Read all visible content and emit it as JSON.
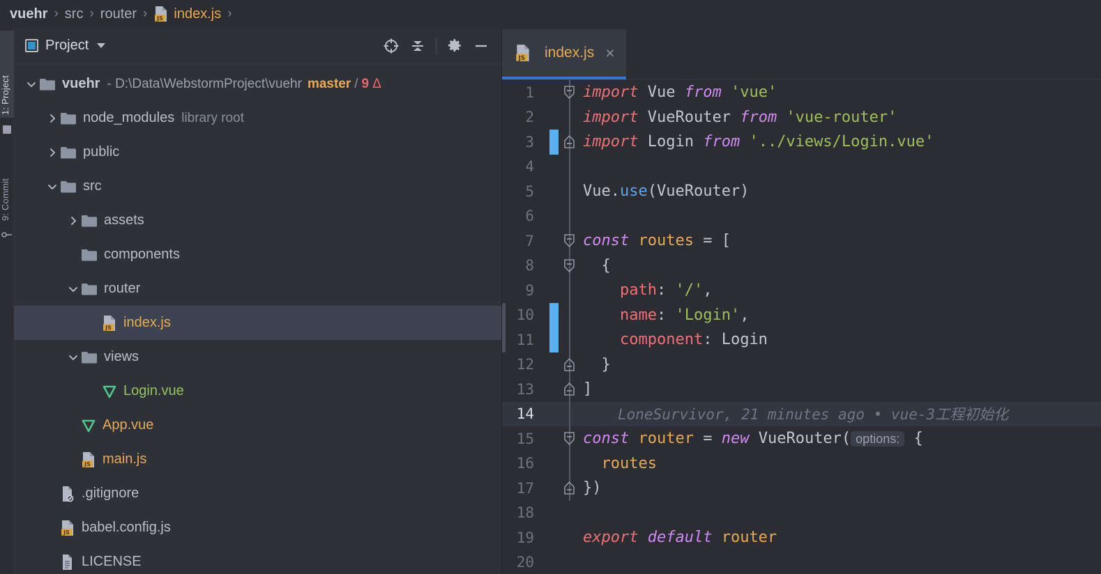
{
  "breadcrumb": {
    "items": [
      {
        "label": "vuehr",
        "style": "bold"
      },
      {
        "label": "src",
        "style": "plain"
      },
      {
        "label": "router",
        "style": "plain"
      },
      {
        "label": "index.js",
        "style": "file",
        "icon": "js-file-icon"
      }
    ],
    "separator": "›"
  },
  "tool_strip": {
    "tabs": [
      {
        "label": "1: Project",
        "active": true,
        "icon": "project-icon"
      },
      {
        "label": "9: Commit",
        "active": false,
        "icon": "branch-icon"
      }
    ]
  },
  "project_panel": {
    "title": "Project",
    "dropdown_icon": "chevron-down-icon",
    "actions": [
      {
        "name": "select-opened-file-icon",
        "title": "Select Opened File"
      },
      {
        "name": "collapse-all-icon",
        "title": "Collapse All"
      },
      {
        "name": "gear-icon",
        "title": "Settings"
      },
      {
        "name": "minimize-icon",
        "title": "Hide"
      }
    ],
    "tree": [
      {
        "id": "root-vuehr",
        "label": "vuehr",
        "indent": 0,
        "twisty": "expanded",
        "icon": "folder-icon",
        "kind": "folder-root",
        "path": "- D:\\Data\\WebstormProject\\vuehr",
        "branch": "master",
        "slash": "/",
        "changes": "9",
        "changes_glyph": "Δ"
      },
      {
        "id": "node_modules",
        "label": "node_modules",
        "indent": 1,
        "twisty": "collapsed",
        "icon": "folder-icon",
        "kind": "folder",
        "sub": "library root"
      },
      {
        "id": "public",
        "label": "public",
        "indent": 1,
        "twisty": "collapsed",
        "icon": "folder-icon",
        "kind": "folder"
      },
      {
        "id": "src",
        "label": "src",
        "indent": 1,
        "twisty": "expanded",
        "icon": "folder-icon",
        "kind": "folder"
      },
      {
        "id": "assets",
        "label": "assets",
        "indent": 2,
        "twisty": "collapsed",
        "icon": "folder-icon",
        "kind": "folder"
      },
      {
        "id": "components",
        "label": "components",
        "indent": 2,
        "twisty": "none",
        "icon": "folder-icon",
        "kind": "folder"
      },
      {
        "id": "router",
        "label": "router",
        "indent": 2,
        "twisty": "expanded",
        "icon": "folder-icon",
        "kind": "folder"
      },
      {
        "id": "router-index",
        "label": "index.js",
        "indent": 3,
        "twisty": "none",
        "icon": "js-file-icon",
        "kind": "js",
        "selected": true
      },
      {
        "id": "views",
        "label": "views",
        "indent": 2,
        "twisty": "expanded",
        "icon": "folder-icon",
        "kind": "folder"
      },
      {
        "id": "login-vue",
        "label": "Login.vue",
        "indent": 3,
        "twisty": "none",
        "icon": "vue-file-icon",
        "kind": "vue"
      },
      {
        "id": "app-vue",
        "label": "App.vue",
        "indent": 2,
        "twisty": "none",
        "icon": "vue-file-icon",
        "kind": "vue-orange"
      },
      {
        "id": "main-js",
        "label": "main.js",
        "indent": 2,
        "twisty": "none",
        "icon": "js-file-icon",
        "kind": "js"
      },
      {
        "id": "gitignore",
        "label": ".gitignore",
        "indent": 1,
        "twisty": "none",
        "icon": "gitignore-file-icon",
        "kind": "plain"
      },
      {
        "id": "babel-config",
        "label": "babel.config.js",
        "indent": 1,
        "twisty": "none",
        "icon": "js-file-icon",
        "kind": "plain"
      },
      {
        "id": "license",
        "label": "LICENSE",
        "indent": 1,
        "twisty": "none",
        "icon": "text-file-icon",
        "kind": "plain"
      }
    ]
  },
  "editor": {
    "tabs": [
      {
        "label": "index.js",
        "icon": "js-file-icon",
        "active": true,
        "close_glyph": "×"
      }
    ],
    "current_line": 14,
    "lines": [
      {
        "n": 1,
        "fold": "start",
        "change": false,
        "tokens": [
          {
            "t": "import",
            "c": "kw2"
          },
          {
            "t": " ",
            "c": "op"
          },
          {
            "t": "Vue",
            "c": "ident"
          },
          {
            "t": " ",
            "c": "op"
          },
          {
            "t": "from",
            "c": "kw"
          },
          {
            "t": " ",
            "c": "op"
          },
          {
            "t": "'vue'",
            "c": "str"
          }
        ]
      },
      {
        "n": 2,
        "fold": "none",
        "change": false,
        "tokens": [
          {
            "t": "import",
            "c": "kw2"
          },
          {
            "t": " ",
            "c": "op"
          },
          {
            "t": "VueRouter",
            "c": "ident"
          },
          {
            "t": " ",
            "c": "op"
          },
          {
            "t": "from",
            "c": "kw"
          },
          {
            "t": " ",
            "c": "op"
          },
          {
            "t": "'vue-router'",
            "c": "str"
          }
        ]
      },
      {
        "n": 3,
        "fold": "end",
        "change": true,
        "tokens": [
          {
            "t": "import",
            "c": "kw2"
          },
          {
            "t": " ",
            "c": "op"
          },
          {
            "t": "Login",
            "c": "ident"
          },
          {
            "t": " ",
            "c": "op"
          },
          {
            "t": "from",
            "c": "kw"
          },
          {
            "t": " ",
            "c": "op"
          },
          {
            "t": "'../views/Login.vue'",
            "c": "str"
          }
        ]
      },
      {
        "n": 4,
        "fold": "none",
        "change": false,
        "tokens": []
      },
      {
        "n": 5,
        "fold": "none",
        "change": false,
        "tokens": [
          {
            "t": "Vue.",
            "c": "ident"
          },
          {
            "t": "use",
            "c": "fn"
          },
          {
            "t": "(VueRouter)",
            "c": "ident"
          }
        ]
      },
      {
        "n": 6,
        "fold": "none",
        "change": false,
        "tokens": []
      },
      {
        "n": 7,
        "fold": "start",
        "change": false,
        "tokens": [
          {
            "t": "const",
            "c": "kw"
          },
          {
            "t": " ",
            "c": "op"
          },
          {
            "t": "routes",
            "c": "var"
          },
          {
            "t": " = [",
            "c": "op"
          }
        ]
      },
      {
        "n": 8,
        "fold": "start",
        "change": false,
        "tokens": [
          {
            "t": "  {",
            "c": "op"
          }
        ]
      },
      {
        "n": 9,
        "fold": "none",
        "change": false,
        "tokens": [
          {
            "t": "    ",
            "c": "op"
          },
          {
            "t": "path",
            "c": "prop"
          },
          {
            "t": ": ",
            "c": "op"
          },
          {
            "t": "'/'",
            "c": "str"
          },
          {
            "t": ",",
            "c": "op"
          }
        ]
      },
      {
        "n": 10,
        "fold": "none",
        "change": true,
        "tokens": [
          {
            "t": "    ",
            "c": "op"
          },
          {
            "t": "name",
            "c": "prop"
          },
          {
            "t": ": ",
            "c": "op"
          },
          {
            "t": "'Login'",
            "c": "str"
          },
          {
            "t": ",",
            "c": "op"
          }
        ]
      },
      {
        "n": 11,
        "fold": "none",
        "change": true,
        "tokens": [
          {
            "t": "    ",
            "c": "op"
          },
          {
            "t": "component",
            "c": "prop"
          },
          {
            "t": ": ",
            "c": "op"
          },
          {
            "t": "Login",
            "c": "ident"
          }
        ]
      },
      {
        "n": 12,
        "fold": "close",
        "change": false,
        "tokens": [
          {
            "t": "  }",
            "c": "op"
          }
        ]
      },
      {
        "n": 13,
        "fold": "close",
        "change": false,
        "tokens": [
          {
            "t": "]",
            "c": "op"
          }
        ]
      },
      {
        "n": 14,
        "fold": "none",
        "change": false,
        "tokens": [],
        "blame": "LoneSurvivor, 21 minutes ago • vue-3工程初始化"
      },
      {
        "n": 15,
        "fold": "start",
        "change": false,
        "tokens": [
          {
            "t": "const",
            "c": "kw"
          },
          {
            "t": " ",
            "c": "op"
          },
          {
            "t": "router",
            "c": "var"
          },
          {
            "t": " = ",
            "c": "op"
          },
          {
            "t": "new",
            "c": "kw"
          },
          {
            "t": " ",
            "c": "op"
          },
          {
            "t": "VueRouter(",
            "c": "ident"
          },
          {
            "t": "options:",
            "c": "inlay"
          },
          {
            "t": " {",
            "c": "op"
          }
        ]
      },
      {
        "n": 16,
        "fold": "none",
        "change": false,
        "tokens": [
          {
            "t": "  ",
            "c": "op"
          },
          {
            "t": "routes",
            "c": "var"
          }
        ]
      },
      {
        "n": 17,
        "fold": "close",
        "change": false,
        "tokens": [
          {
            "t": "})",
            "c": "op"
          }
        ]
      },
      {
        "n": 18,
        "fold": "none",
        "change": false,
        "tokens": []
      },
      {
        "n": 19,
        "fold": "none",
        "change": false,
        "tokens": [
          {
            "t": "export",
            "c": "kw2"
          },
          {
            "t": " ",
            "c": "op"
          },
          {
            "t": "default",
            "c": "kw"
          },
          {
            "t": " ",
            "c": "op"
          },
          {
            "t": "router",
            "c": "var"
          }
        ]
      },
      {
        "n": 20,
        "fold": "none",
        "change": false,
        "tokens": []
      }
    ]
  },
  "colors": {
    "background": "#2b2d33",
    "panel_background": "#2f3138",
    "selection": "#3d4350",
    "tab_active": "#363a43",
    "tab_underline": "#3675d3",
    "accent_js": "#e8ab53",
    "accent_vue": "#95c360",
    "change_bar": "#5ab1ef",
    "keyword": "#cf8bf3",
    "import_keyword": "#f07178",
    "string": "#9fc05a",
    "branch": "#e8ab53",
    "changes": "#e8676b"
  }
}
